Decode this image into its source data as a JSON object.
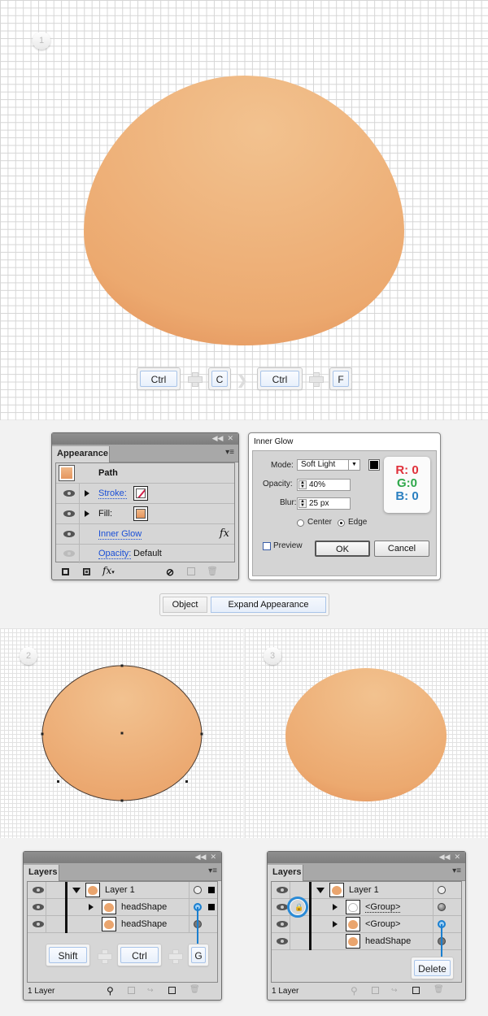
{
  "step1": {
    "number": "1",
    "shape_color_top": "#f2c08c",
    "shape_color_bottom": "#e5955e",
    "shortcut": [
      {
        "type": "key",
        "label": "Ctrl"
      },
      {
        "type": "plus"
      },
      {
        "type": "key",
        "label": "C"
      },
      {
        "type": "arrow"
      },
      {
        "type": "key",
        "label": "Ctrl"
      },
      {
        "type": "plus"
      },
      {
        "type": "key",
        "label": "F"
      }
    ]
  },
  "appearance_panel": {
    "tab_label": "Appearance",
    "title_label": "Path",
    "rows": [
      {
        "label": "Stroke:",
        "swatch": "none"
      },
      {
        "label": "Fill:",
        "swatch": "#eaa56e"
      },
      {
        "label": "Inner Glow",
        "fx": "fx"
      },
      {
        "label": "Opacity:",
        "value": "Default"
      }
    ],
    "fx_label": "fx"
  },
  "inner_glow_dialog": {
    "title": "Inner Glow",
    "mode_label": "Mode:",
    "mode_value": "Soft Light",
    "opacity_label": "Opacity:",
    "opacity_value": "40%",
    "blur_label": "Blur:",
    "blur_value": "25 px",
    "center_label": "Center",
    "edge_label": "Edge",
    "selected_position": "Edge",
    "preview_label": "Preview",
    "preview_checked": false,
    "ok_label": "OK",
    "cancel_label": "Cancel",
    "color_swatch": "#000000",
    "rgb": {
      "r": "R: 0",
      "g": "G:0",
      "b": "B: 0"
    },
    "rgb_colors": {
      "r": "#e0303a",
      "g": "#2ea84a",
      "b": "#2a7fc0"
    }
  },
  "menu_path": {
    "first": "Object",
    "second": "Expand Appearance"
  },
  "step2": {
    "number": "2"
  },
  "step3": {
    "number": "3"
  },
  "layers_left": {
    "tab_label": "Layers",
    "rows": [
      {
        "name": "Layer 1",
        "expanded": true
      },
      {
        "name": "headShape",
        "expandable": true
      },
      {
        "name": "headShape"
      }
    ],
    "shortcut": [
      {
        "type": "key",
        "label": "Shift"
      },
      {
        "type": "plus"
      },
      {
        "type": "key",
        "label": "Ctrl"
      },
      {
        "type": "plus"
      },
      {
        "type": "key",
        "label": "G"
      }
    ],
    "footer_label": "1 Layer"
  },
  "layers_right": {
    "tab_label": "Layers",
    "rows": [
      {
        "name": "Layer 1",
        "expanded": true
      },
      {
        "name": "<Group>",
        "expandable": true,
        "locked": true
      },
      {
        "name": "<Group>",
        "expandable": true
      },
      {
        "name": "headShape"
      }
    ],
    "delete_label": "Delete",
    "footer_label": "1 Layer"
  }
}
